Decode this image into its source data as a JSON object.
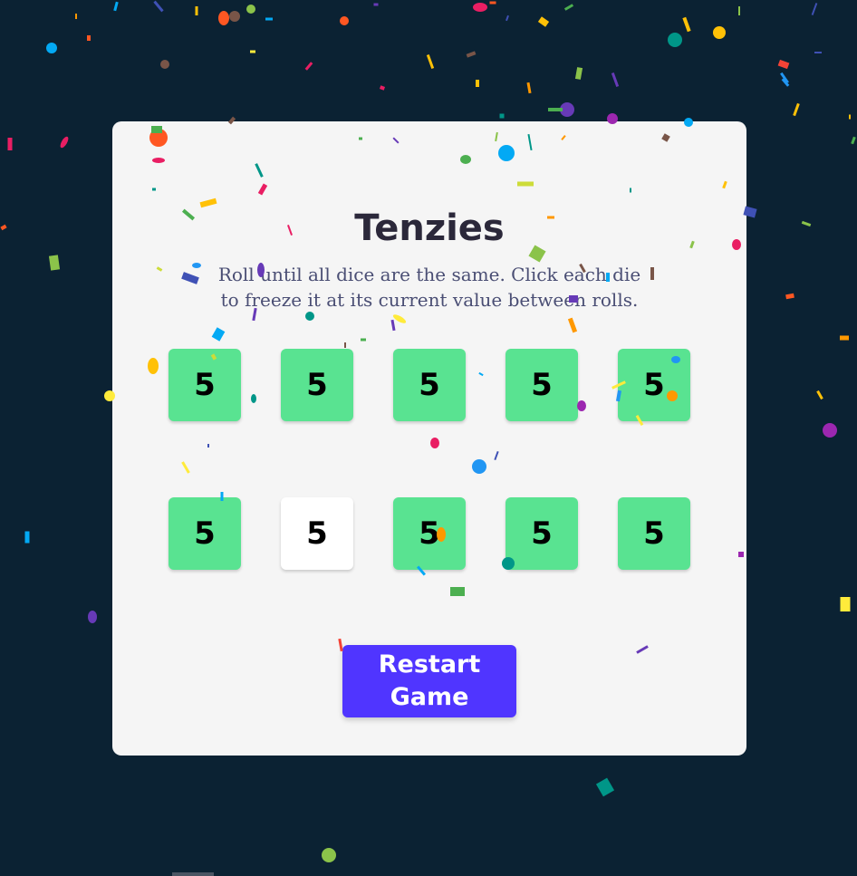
{
  "game": {
    "title": "Tenzies",
    "instructions": "Roll until all dice are the same. Click each die to freeze it at its current value between rolls.",
    "button_label": "Restart Game",
    "won": true,
    "dice": [
      {
        "value": "5",
        "held": true
      },
      {
        "value": "5",
        "held": true
      },
      {
        "value": "5",
        "held": true
      },
      {
        "value": "5",
        "held": true
      },
      {
        "value": "5",
        "held": true
      },
      {
        "value": "5",
        "held": true
      },
      {
        "value": "5",
        "held": false
      },
      {
        "value": "5",
        "held": true
      },
      {
        "value": "5",
        "held": true
      },
      {
        "value": "5",
        "held": true
      }
    ]
  },
  "colors": {
    "background": "#0b2233",
    "card": "#f5f5f5",
    "held_die": "#59e391",
    "free_die": "#ffffff",
    "button": "#5035ff",
    "title": "#2b283a",
    "instructions": "#4a4e74"
  },
  "confetti": {
    "visible": true,
    "palette": [
      "#f44336",
      "#e91e63",
      "#9c27b0",
      "#673ab7",
      "#3f51b5",
      "#2196f3",
      "#03a9f4",
      "#009688",
      "#4caf50",
      "#8bc34a",
      "#cddc39",
      "#ffeb3b",
      "#ffc107",
      "#ff9800",
      "#ff5722",
      "#795548"
    ]
  }
}
